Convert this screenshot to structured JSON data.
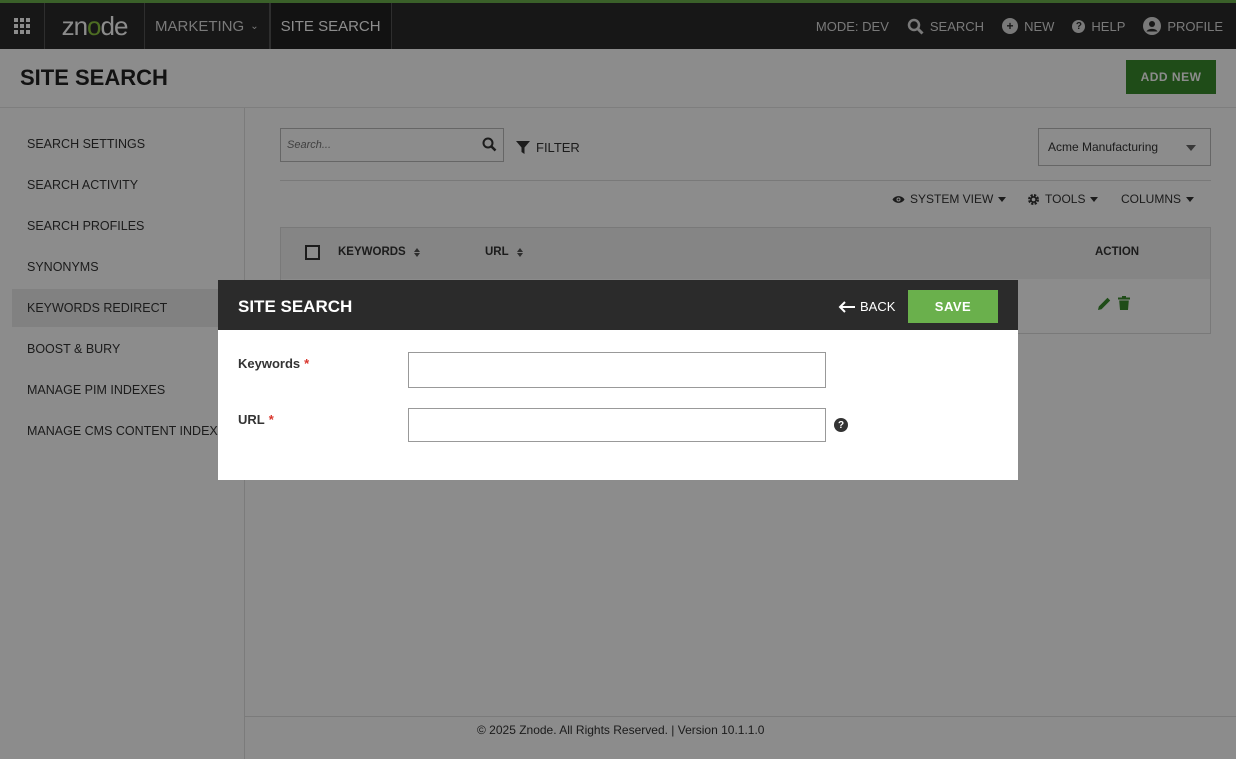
{
  "topbar": {
    "logo_text": "znode",
    "nav": [
      {
        "label": "MARKETING"
      },
      {
        "label": "SITE SEARCH"
      }
    ],
    "mode": "MODE: DEV",
    "search_label": "SEARCH",
    "new_label": "NEW",
    "help_label": "HELP",
    "profile_label": "PROFILE"
  },
  "header": {
    "title": "SITE SEARCH",
    "add_new_label": "ADD NEW"
  },
  "sidebar": {
    "items": [
      {
        "label": "SEARCH SETTINGS"
      },
      {
        "label": "SEARCH ACTIVITY"
      },
      {
        "label": "SEARCH PROFILES"
      },
      {
        "label": "SYNONYMS"
      },
      {
        "label": "KEYWORDS REDIRECT",
        "active": true
      },
      {
        "label": "BOOST & BURY"
      },
      {
        "label": "MANAGE PIM INDEXES"
      },
      {
        "label": "MANAGE CMS CONTENT INDEXES"
      }
    ]
  },
  "toolbar": {
    "search_placeholder": "Search...",
    "filter_label": "FILTER",
    "portal_selected": "Acme Manufacturing",
    "system_view_label": "SYSTEM VIEW",
    "tools_label": "TOOLS",
    "columns_label": "COLUMNS"
  },
  "grid": {
    "columns": [
      "KEYWORDS",
      "URL",
      "ACTION"
    ]
  },
  "footer": {
    "text": "© 2025 Znode. All Rights Reserved. | Version 10.1.1.0"
  },
  "modal": {
    "title": "SITE SEARCH",
    "back_label": "BACK",
    "save_label": "SAVE",
    "fields": [
      {
        "label": "Keywords",
        "required_mark": "*",
        "value": ""
      },
      {
        "label": "URL",
        "required_mark": "*",
        "value": ""
      }
    ],
    "help_glyph": "?"
  },
  "colors": {
    "accent_green": "#6ab04c",
    "dark_green": "#3a8b2c",
    "topbar_bg": "#2b2b2b",
    "required_red": "#d9342b"
  }
}
